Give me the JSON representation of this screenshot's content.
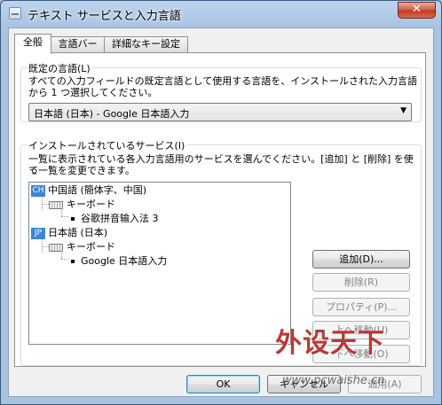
{
  "window": {
    "title": "テキスト サービスと入力言語",
    "close_glyph": "✕"
  },
  "tabs": [
    {
      "label": "全般",
      "active": true
    },
    {
      "label": "言語バー",
      "active": false
    },
    {
      "label": "詳細なキー設定",
      "active": false
    }
  ],
  "default_language": {
    "group_title": "既定の言語(L)",
    "description_line1": "すべての入力フィールドの既定言語として使用する言語を、インストールされた入力言語",
    "description_line2": "から 1 つ選択してください。",
    "selected": "日本語 (日本) - Google 日本語入力"
  },
  "installed_services": {
    "group_title": "インストールされているサービス(I)",
    "description_line1": "一覧に表示されている各入力言語用のサービスを選んでください。[追加] と [削除] を使っ",
    "description_line2": "て一覧を変更できます。",
    "tree": [
      {
        "badge": "CH",
        "label": "中国語 (簡体字、中国)",
        "category": "キーボード",
        "service": "谷歌拼音输入法 3"
      },
      {
        "badge": "JP",
        "label": "日本語 (日本)",
        "category": "キーボード",
        "service": "Google 日本語入力"
      }
    ],
    "buttons": {
      "add": "追加(D)...",
      "remove": "削除(R)",
      "properties": "プロパティ(P)...",
      "move_up": "上へ移動(U)",
      "move_down": "下へ移動(O)"
    }
  },
  "footer": {
    "ok": "OK",
    "cancel": "キャンセル",
    "apply": "適用(A)"
  },
  "watermark": {
    "text": "外设天下",
    "url": "www.pcwaishe.cn"
  }
}
